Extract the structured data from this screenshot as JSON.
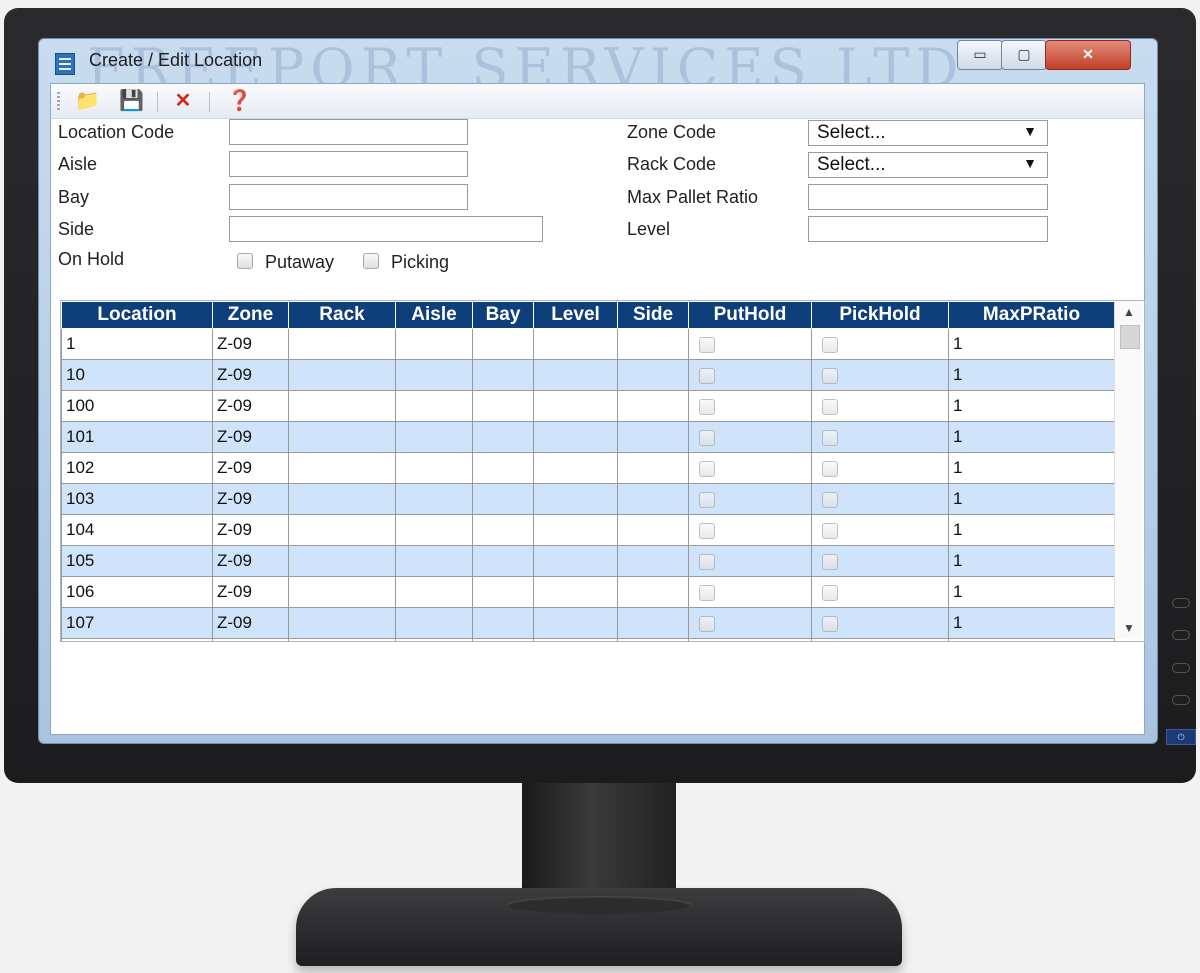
{
  "window": {
    "title": "Create / Edit Location",
    "watermark": "FREEPORT SERVICES LTD",
    "minimize": "▭",
    "maximize": "▢",
    "close": "✕"
  },
  "toolbar": {
    "new_icon": "📁",
    "save_icon": "💾",
    "delete_icon": "✕",
    "help_icon": "❓"
  },
  "form": {
    "location_code_label": "Location Code",
    "aisle_label": "Aisle",
    "bay_label": "Bay",
    "side_label": "Side",
    "on_hold_label": "On Hold",
    "putaway_label": "Putaway",
    "picking_label": "Picking",
    "zone_code_label": "Zone Code",
    "rack_code_label": "Rack Code",
    "max_pallet_ratio_label": "Max Pallet Ratio",
    "level_label": "Level",
    "zone_code_value": "Select...",
    "rack_code_value": "Select...",
    "dropdown_arrow": "▼"
  },
  "grid": {
    "columns": [
      "Location",
      "Zone",
      "Rack",
      "Aisle",
      "Bay",
      "Level",
      "Side",
      "PutHold",
      "PickHold",
      "MaxPRatio"
    ],
    "rows": [
      {
        "location": "1",
        "zone": "Z-09",
        "ratio": "1"
      },
      {
        "location": "10",
        "zone": "Z-09",
        "ratio": "1"
      },
      {
        "location": "100",
        "zone": "Z-09",
        "ratio": "1"
      },
      {
        "location": "101",
        "zone": "Z-09",
        "ratio": "1"
      },
      {
        "location": "102",
        "zone": "Z-09",
        "ratio": "1"
      },
      {
        "location": "103",
        "zone": "Z-09",
        "ratio": "1"
      },
      {
        "location": "104",
        "zone": "Z-09",
        "ratio": "1"
      },
      {
        "location": "105",
        "zone": "Z-09",
        "ratio": "1"
      },
      {
        "location": "106",
        "zone": "Z-09",
        "ratio": "1"
      },
      {
        "location": "107",
        "zone": "Z-09",
        "ratio": "1"
      }
    ],
    "scroll_up": "▲",
    "scroll_down": "▼"
  },
  "monitor": {
    "power_icon": "⏻"
  },
  "colors": {
    "header_bg": "#0e3f7a",
    "alt_row": "#cfe3fa"
  }
}
